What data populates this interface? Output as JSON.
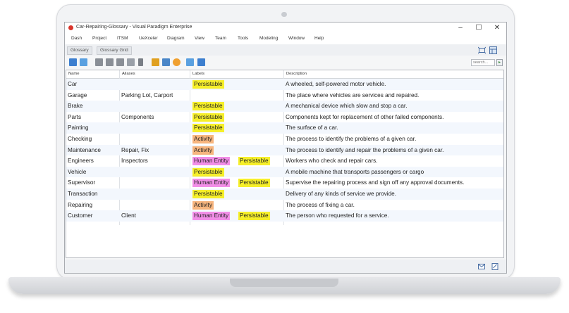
{
  "window": {
    "title": "Car-Repairing-Glossary - Visual Paradigm Enterprise",
    "min_glyph": "–",
    "max_glyph": "☐",
    "close_glyph": "✕"
  },
  "menu": [
    "Dash",
    "Project",
    "ITSM",
    "UeXceler",
    "Diagram",
    "View",
    "Team",
    "Tools",
    "Modeling",
    "Window",
    "Help"
  ],
  "breadcrumb": [
    "Glossary",
    "Glossary Grid"
  ],
  "search": {
    "placeholder": "search..."
  },
  "colors": {
    "persistable": "#f6ef2a",
    "activity": "#f7b57e",
    "human_entity": "#f28ee8",
    "alt_row": "#f3f7fd"
  },
  "grid": {
    "columns": [
      "Name",
      "Aliases",
      "Labels",
      "Description"
    ],
    "rows": [
      {
        "name": "Car",
        "aliases": "",
        "labels": [
          "Persistable"
        ],
        "description": "A wheeled, self-powered motor vehicle."
      },
      {
        "name": "Garage",
        "aliases": "Parking Lot, Carport",
        "labels": [],
        "description": "The place where vehicles are services and repaired."
      },
      {
        "name": "Brake",
        "aliases": "",
        "labels": [
          "Persistable"
        ],
        "description": "A mechanical device which slow and stop a car."
      },
      {
        "name": "Parts",
        "aliases": "Components",
        "labels": [
          "Persistable"
        ],
        "description": "Components kept for replacement of other failed components."
      },
      {
        "name": "Painting",
        "aliases": "",
        "labels": [
          "Persistable"
        ],
        "description": "The surface of a car."
      },
      {
        "name": "Checking",
        "aliases": "",
        "labels": [
          "Activity"
        ],
        "description": "The process to identify the problems of a given car."
      },
      {
        "name": "Maintenance",
        "aliases": "Repair, Fix",
        "labels": [
          "Activity"
        ],
        "description": "The process to identify and repair the problems of a given car."
      },
      {
        "name": "Engineers",
        "aliases": "Inspectors",
        "labels": [
          "Human Entity",
          "Persistable"
        ],
        "description": "Workers who check and repair cars."
      },
      {
        "name": "Vehicle",
        "aliases": "",
        "labels": [
          "Persistable"
        ],
        "description": "A mobile machine that transports passengers or cargo"
      },
      {
        "name": "Supervisor",
        "aliases": "",
        "labels": [
          "Human Entity",
          "Persistable"
        ],
        "description": "Supervise the repairing process and sign off any approval documents."
      },
      {
        "name": "Transaction",
        "aliases": "",
        "labels": [
          "Persistable"
        ],
        "description": "Delivery of any kinds of service we provide."
      },
      {
        "name": "Repairing",
        "aliases": "",
        "labels": [
          "Activity"
        ],
        "description": "The process of fixing a car."
      },
      {
        "name": "Customer",
        "aliases": "Client",
        "labels": [
          "Human Entity",
          "Persistable"
        ],
        "description": "The person who requested for a service."
      }
    ]
  },
  "toolbar_icons": [
    "new-term-icon",
    "import-icon",
    "document-icon",
    "document-alt-icon",
    "table-icon",
    "folder-icon",
    "pin-icon",
    "chart-icon",
    "diagram-icon",
    "refresh-icon",
    "export-icon",
    "report-icon"
  ]
}
